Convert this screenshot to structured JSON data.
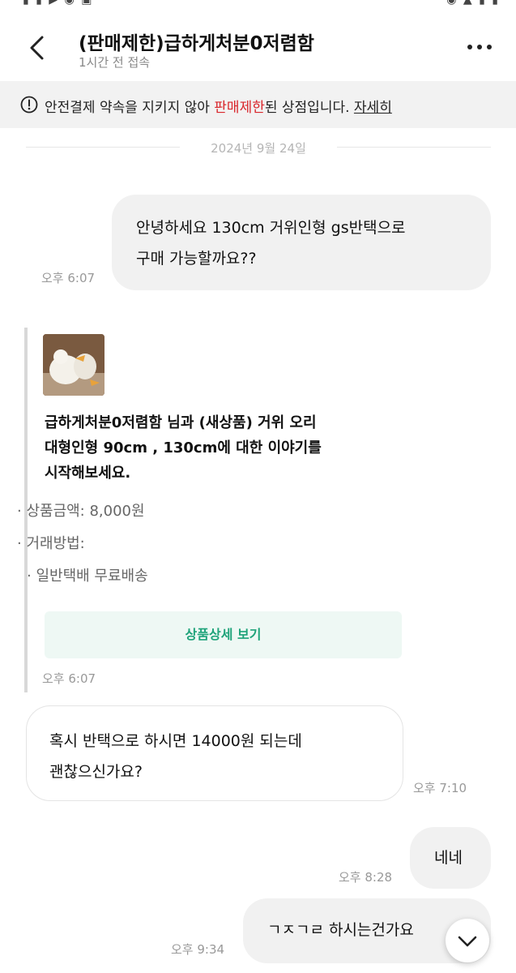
{
  "header": {
    "title": "(판매제한)급하게처분0저렴함",
    "subtitle": "1시간 전 접속"
  },
  "notice": {
    "prefix": "안전결제 약속을 지키지 않아 ",
    "highlight": "판매제한",
    "suffix": "된 상점입니다. ",
    "link": "자세히",
    "highlight_color": "#d9262b"
  },
  "date_divider": "2024년 9월 24일",
  "messages": [
    {
      "lines": [
        "안녕하세요 130cm 거위인형 gs반택으로",
        "구매 가능할까요??"
      ],
      "time": "오후 6:07"
    },
    {
      "lines": [
        "혹시 반택으로 하시면 14000원 되는데",
        "괜찮으신가요?"
      ],
      "time": "오후 7:10"
    },
    {
      "lines": [
        "네네"
      ],
      "time": "오후 8:28"
    },
    {
      "lines": [
        "ㄱㅈㄱㄹ 하시는건가요"
      ],
      "time": "오후 9:34"
    }
  ],
  "product_card": {
    "lines": [
      "급하게처분0저렴함 님과 (새상품) 거위 오리",
      "대형인형 90cm , 130cm에 대한 이야기를",
      "시작해보세요."
    ],
    "price": "· 상품금액: 8,000원",
    "method_label": "· 거래방법:",
    "method_value": "· 일반택배 무료배송",
    "detail_button": "상품상세 보기",
    "time": "오후 6:07"
  },
  "icons": {
    "back": "chevron-left-icon",
    "more": "more-dots-icon",
    "notice": "exclamation-circle-icon",
    "scroll": "chevron-down-icon"
  },
  "colors": {
    "accent_green": "#1fa37a",
    "detail_bg": "#eef8f4"
  }
}
